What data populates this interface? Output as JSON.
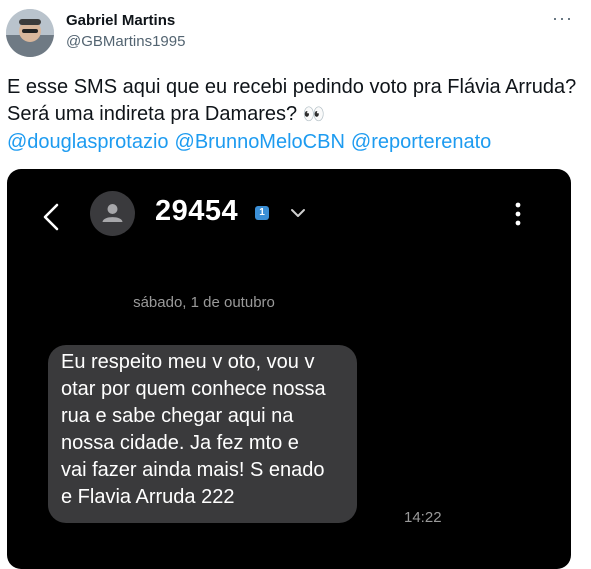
{
  "tweet": {
    "author_name": "Gabriel Martins",
    "author_handle": "@GBMartins1995",
    "more_icon": "more-horizontal-icon",
    "text": "E esse SMS aqui que eu recebi pedindo voto pra Flávia Arruda? Será uma indireta pra Damares?",
    "emoji": "👀",
    "mentions": [
      "@douglasprotazio",
      "@BrunnoMeloCBN",
      "@reporterenato"
    ],
    "mention_color": "#1d9bf0"
  },
  "sms_screen": {
    "back_icon": "back-arrow-icon",
    "contact_icon": "person-icon",
    "sender_number": "29454",
    "sim_badge": "1",
    "chevron_icon": "chevron-down-icon",
    "menu_icon": "more-vertical-icon",
    "date_divider": "sábado, 1 de outubro",
    "message_lines": [
      "Eu respeito meu v oto, vou v",
      "otar por quem conhece nossa",
      "rua e sabe chegar aqui na",
      "nossa cidade. Ja fez mto e",
      "vai fazer ainda mais! S enado",
      "e Flavia Arruda 222"
    ],
    "message_time": "14:22",
    "bubble_color": "#3a3a3c",
    "background_color": "#000000"
  }
}
